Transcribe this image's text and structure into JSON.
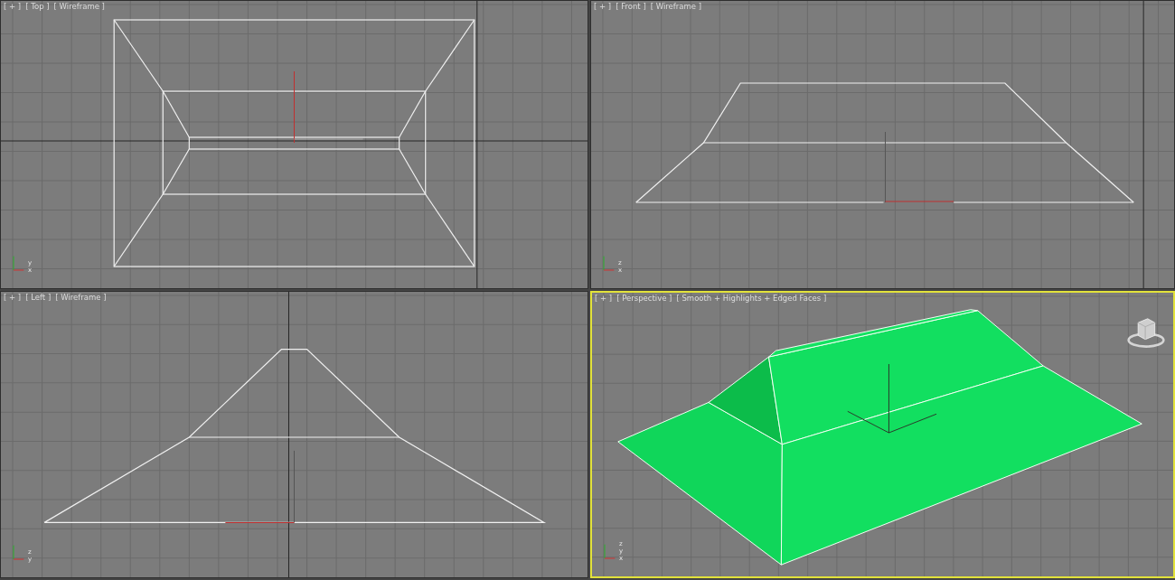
{
  "viewports": [
    {
      "kind": "top",
      "menu": "[ + ]",
      "view": "[ Top ]",
      "shading": "[ Wireframe ]",
      "selected": false,
      "axis_labels": [
        "y",
        "x"
      ]
    },
    {
      "kind": "front",
      "menu": "[ + ]",
      "view": "[ Front ]",
      "shading": "[ Wireframe ]",
      "selected": false,
      "axis_labels": [
        "z",
        "x"
      ]
    },
    {
      "kind": "left",
      "menu": "[ + ]",
      "view": "[ Left ]",
      "shading": "[ Wireframe ]",
      "selected": false,
      "axis_labels": [
        "z",
        "y"
      ]
    },
    {
      "kind": "perspective",
      "menu": "[ + ]",
      "view": "[ Perspective ]",
      "shading": "[ Smooth + Highlights + Edged Faces ]",
      "selected": true,
      "axis_labels": [
        "z",
        "y",
        "x"
      ]
    }
  ]
}
